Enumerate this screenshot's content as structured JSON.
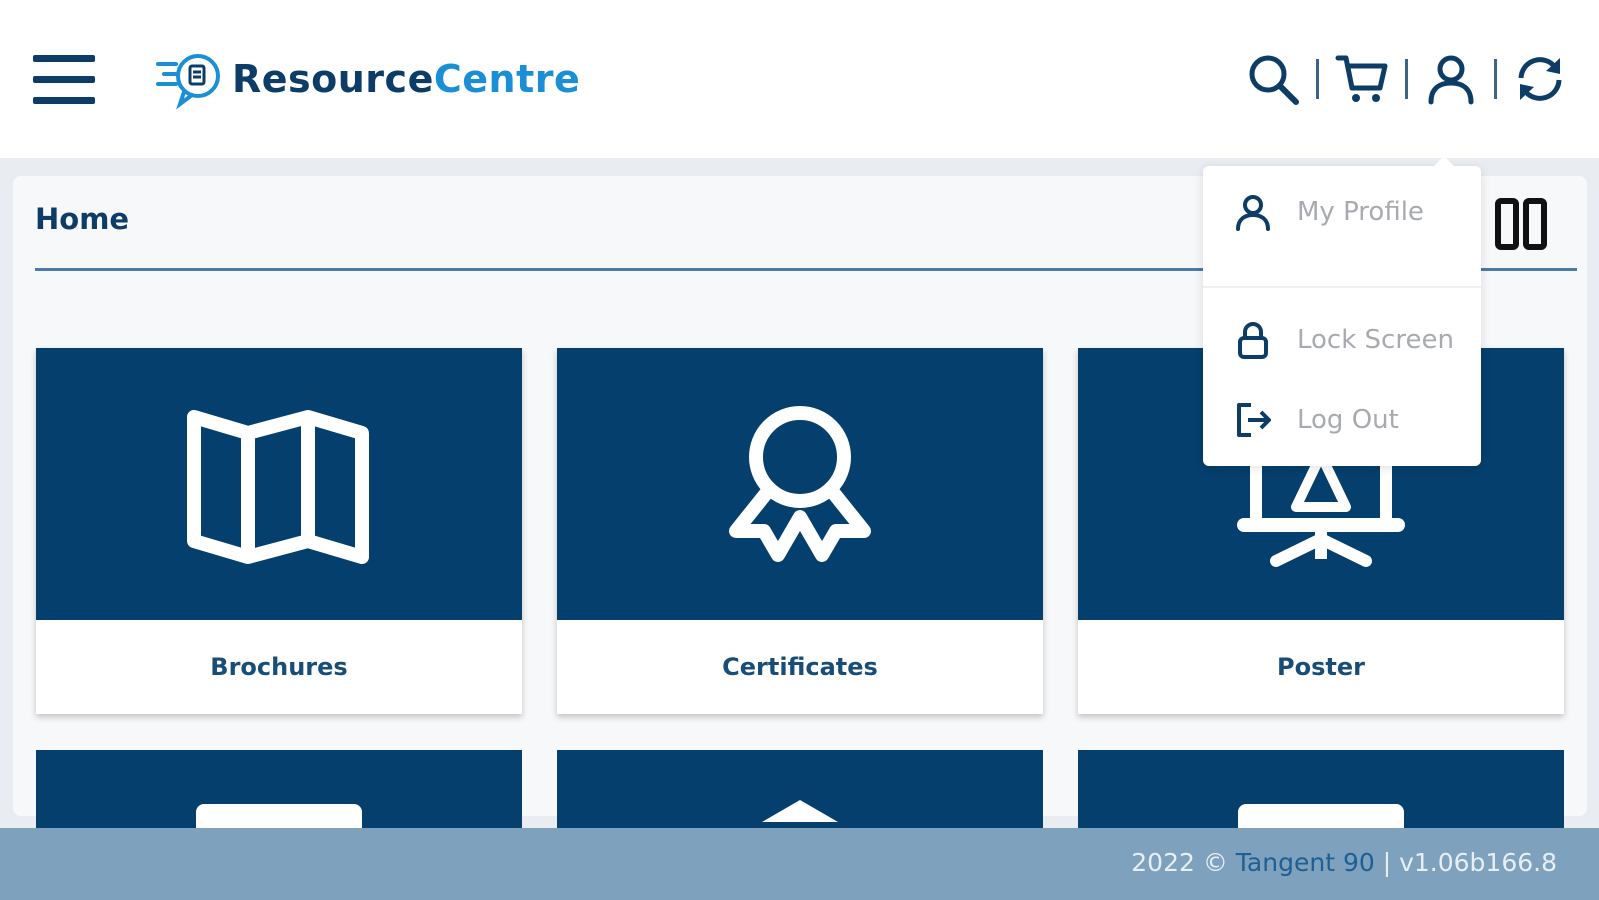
{
  "header": {
    "brand_part1": "Resource",
    "brand_part2": "Centre",
    "tools": [
      "search-icon",
      "cart-icon",
      "user-icon",
      "refresh-icon"
    ]
  },
  "page": {
    "title": "Home"
  },
  "tiles": [
    {
      "label": "Brochures",
      "icon": "map-icon"
    },
    {
      "label": "Certificates",
      "icon": "award-icon"
    },
    {
      "label": "Poster",
      "icon": "presentation-easel-icon"
    }
  ],
  "user_menu": {
    "items": [
      {
        "label": "My Profile",
        "icon": "user-icon"
      },
      {
        "label": "Lock Screen",
        "icon": "lock-icon"
      },
      {
        "label": "Log Out",
        "icon": "logout-icon"
      }
    ]
  },
  "footer": {
    "year": "2022 ©",
    "company": "Tangent 90",
    "separator": "|",
    "version": "v1.06b166.8"
  },
  "colors": {
    "navy": "#0d3d66",
    "tile_blue": "#053f6d",
    "accent_blue": "#1a8fd6",
    "footer_bg": "#7ea1bd"
  }
}
